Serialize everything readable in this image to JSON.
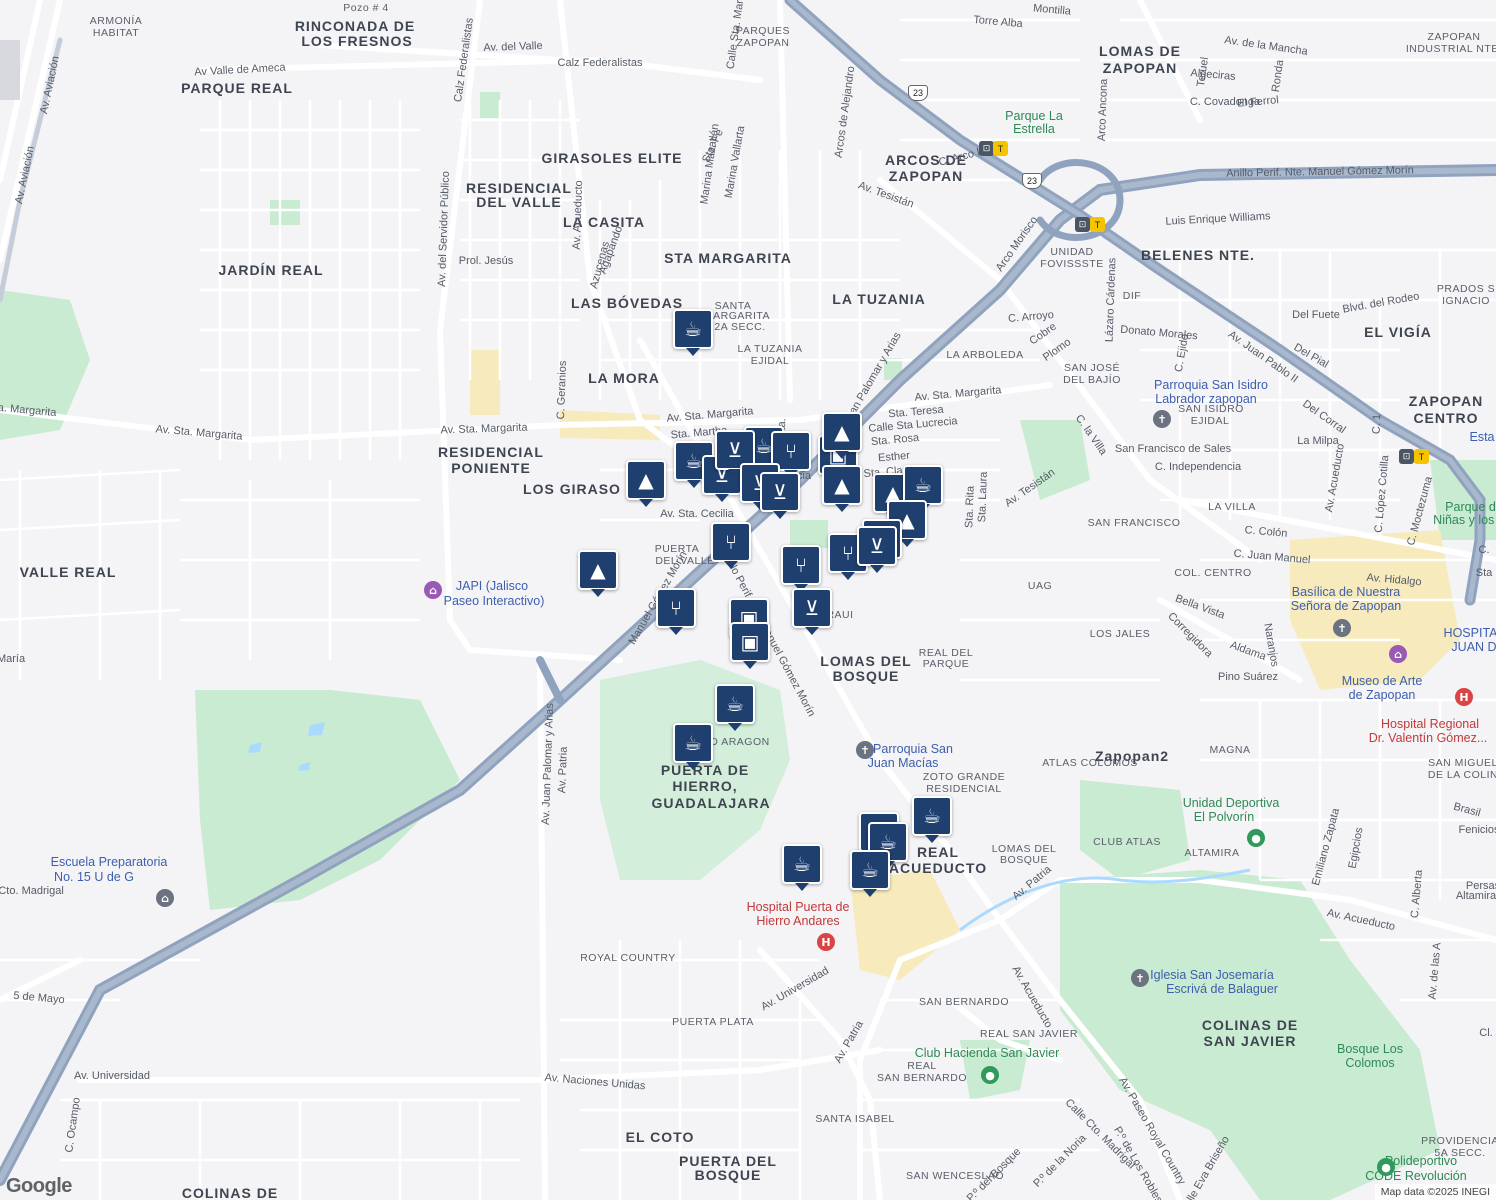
{
  "map": {
    "google_logo": "Google",
    "attribution": "Map data ©2025 INEGI",
    "neighborhoods": [
      {
        "text": "RINCONADA DE"
      },
      {
        "text": "LOS FRESNOS"
      },
      {
        "text": "PARQUE REAL"
      },
      {
        "text": "GIRASOLES ELITE"
      },
      {
        "text": "RESIDENCIAL"
      },
      {
        "text": "DEL VALLE"
      },
      {
        "text": "LA CASITA"
      },
      {
        "text": "JARDÍN REAL"
      },
      {
        "text": "STA MARGARITA"
      },
      {
        "text": "LAS BÓVEDAS"
      },
      {
        "text": "LA TUZANIA"
      },
      {
        "text": "LA MORA"
      },
      {
        "text": "RESIDENCIAL"
      },
      {
        "text": "PONIENTE"
      },
      {
        "text": "LOS GIRASO"
      },
      {
        "text": "VALLE REAL"
      },
      {
        "text": "LOMAS DE"
      },
      {
        "text": "ZAPOPAN"
      },
      {
        "text": "ARCOS DE"
      },
      {
        "text": "ZAPOPAN"
      },
      {
        "text": "BELENES NTE."
      },
      {
        "text": "EL VIGÍA"
      },
      {
        "text": "ZAPOPAN"
      },
      {
        "text": "CENTRO"
      },
      {
        "text": "LOMAS DEL"
      },
      {
        "text": "BOSQUE"
      },
      {
        "text": "PUERTA DE"
      },
      {
        "text": "HIERRO,"
      },
      {
        "text": "GUADALAJARA"
      },
      {
        "text": "REAL"
      },
      {
        "text": "ACUEDUCTO"
      },
      {
        "text": "COLINAS DE"
      },
      {
        "text": "SAN JAVIER"
      },
      {
        "text": "EL COTO"
      },
      {
        "text": "PUERTA DEL"
      },
      {
        "text": "BOSQUE"
      },
      {
        "text": "COLINAS DE"
      },
      {
        "text": "Zapopan2"
      }
    ],
    "small_labels": [
      {
        "text": "ARMONÍA"
      },
      {
        "text": "HABITAT"
      },
      {
        "text": "PARQUES"
      },
      {
        "text": "ZAPOPAN"
      },
      {
        "text": "SANTA"
      },
      {
        "text": "MARGARITA"
      },
      {
        "text": "2A SECC."
      },
      {
        "text": "LA TUZANIA"
      },
      {
        "text": "EJIDAL"
      },
      {
        "text": "LA ARBOLEDA"
      },
      {
        "text": "SAN JOSÉ"
      },
      {
        "text": "DEL BAJÍO"
      },
      {
        "text": "UNIDAD"
      },
      {
        "text": "FOVISSSTE"
      },
      {
        "text": "DIF"
      },
      {
        "text": "SAN ISIDRO"
      },
      {
        "text": "EJIDAL"
      },
      {
        "text": "SAN FRANCISCO"
      },
      {
        "text": "LA VILLA"
      },
      {
        "text": "COL. CENTRO"
      },
      {
        "text": "UAG"
      },
      {
        "text": "LOS JALES"
      },
      {
        "text": "REAL DEL"
      },
      {
        "text": "PARQUE"
      },
      {
        "text": "MAGNA"
      },
      {
        "text": "ATLAS COLOMOS"
      },
      {
        "text": "ZOTO GRANDE"
      },
      {
        "text": "RESIDENCIAL"
      },
      {
        "text": "LOMAS DEL"
      },
      {
        "text": "BOSQUE"
      },
      {
        "text": "CLUB ATLAS"
      },
      {
        "text": "ALTAMIRA"
      },
      {
        "text": "ROYAL COUNTRY"
      },
      {
        "text": "SAN BERNARDO"
      },
      {
        "text": "REAL SAN JAVIER"
      },
      {
        "text": "REAL"
      },
      {
        "text": "SAN BERNARDO"
      },
      {
        "text": "PUERTA PLATA"
      },
      {
        "text": "SANTA ISABEL"
      },
      {
        "text": "SAN WENCESLAO"
      },
      {
        "text": "PROVIDENCIA"
      },
      {
        "text": "5A SECC."
      },
      {
        "text": "ZAPOPAN"
      },
      {
        "text": "INDUSTRIAL NTE."
      },
      {
        "text": "PRADOS S"
      },
      {
        "text": "IGNACIO"
      },
      {
        "text": "PUERTA"
      },
      {
        "text": "DEL VALLE"
      },
      {
        "text": "SAN MIGUEL"
      },
      {
        "text": "DE LA COLIN"
      },
      {
        "text": "RAUI"
      },
      {
        "text": "D ARAGON"
      },
      {
        "text": "Pozo # 4"
      }
    ],
    "streets": [
      {
        "text": "Av. Aviación"
      },
      {
        "text": "Av. Aviación"
      },
      {
        "text": "Calz Federalistas"
      },
      {
        "text": "Av. del Valle"
      },
      {
        "text": "Calz Federalistas"
      },
      {
        "text": "Av Valle de Ameca"
      },
      {
        "text": "Av. del Servidor Público"
      },
      {
        "text": "Av. Acueducto"
      },
      {
        "text": "Agapando"
      },
      {
        "text": "Azucenas"
      },
      {
        "text": "Prol. Jesús"
      },
      {
        "text": "C. Geranios"
      },
      {
        "text": "Sta. Fe"
      },
      {
        "text": "Marina Mazatlán"
      },
      {
        "text": "Marina Vallarta"
      },
      {
        "text": "Calle Sta. María"
      },
      {
        "text": "Arcos de Alejandro"
      },
      {
        "text": "Av. Tesistán"
      },
      {
        "text": "C. Arco Iris"
      },
      {
        "text": "Av. de la Mancha"
      },
      {
        "text": "Algeciras"
      },
      {
        "text": "El Ferrol"
      },
      {
        "text": "C. Covadonga"
      },
      {
        "text": "Torre Alba"
      },
      {
        "text": "Montilla"
      },
      {
        "text": "Teruel"
      },
      {
        "text": "Ronda"
      },
      {
        "text": "Arco Ancona"
      },
      {
        "text": "Anillo Perif. Nte. Manuel Gómez Morín"
      },
      {
        "text": "Luis Enrique Williams"
      },
      {
        "text": "Arco Morisco"
      },
      {
        "text": "C. Arroyo"
      },
      {
        "text": "Cobre"
      },
      {
        "text": "Plomo"
      },
      {
        "text": "Lázaro Cárdenas"
      },
      {
        "text": "Donato Morales"
      },
      {
        "text": "Av. Juan Pablo II"
      },
      {
        "text": "Blvd. del Rodeo"
      },
      {
        "text": "Del Fuete"
      },
      {
        "text": "Del Pial"
      },
      {
        "text": "Del Corral"
      },
      {
        "text": "La Milpa"
      },
      {
        "text": "C. Ejido"
      },
      {
        "text": "C. 1"
      },
      {
        "text": "Av. Sta. Margarita"
      },
      {
        "text": "Av. Sta. Margarita"
      },
      {
        "text": "Av. Sta. Margarita"
      },
      {
        "text": "Sta. Margarita"
      },
      {
        "text": "Av. Sta. Margarita"
      },
      {
        "text": "Sta. Martha"
      },
      {
        "text": "Sta. Teresa"
      },
      {
        "text": "Calle Sta Lucrecia"
      },
      {
        "text": "Sta. Rosa"
      },
      {
        "text": "Esther"
      },
      {
        "text": "Sta. Clara"
      },
      {
        "text": "Av. Sta. Cecilia"
      },
      {
        "text": "Sta. Rita"
      },
      {
        "text": "Sta. Laura"
      },
      {
        "text": "Av. Tesistán"
      },
      {
        "text": "C. la Villa"
      },
      {
        "text": "San Francisco de Sales"
      },
      {
        "text": "C. Independencia"
      },
      {
        "text": "C. Colón"
      },
      {
        "text": "C. Juan Manuel"
      },
      {
        "text": "Av. Hidalgo"
      },
      {
        "text": "Bella Vista"
      },
      {
        "text": "Corregidora"
      },
      {
        "text": "Aldama"
      },
      {
        "text": "Naranjos"
      },
      {
        "text": "Pino Suárez"
      },
      {
        "text": "C. López Cotilla"
      },
      {
        "text": "C. Moctezuma"
      },
      {
        "text": "Av. Acueducto"
      },
      {
        "text": "Anillo Perif. Nte. Manuel Gómez Morín"
      },
      {
        "text": "Manuel Gómez Morín"
      },
      {
        "text": "Av. Juan Palomar y Arias"
      },
      {
        "text": "Av. Juan Palomar y Arias"
      },
      {
        "text": "Av. Patria"
      },
      {
        "text": "Av. Patria"
      },
      {
        "text": "Av. Patria"
      },
      {
        "text": "Av. Acueducto"
      },
      {
        "text": "Av. Acueducto"
      },
      {
        "text": "Av. Paseo Royal Country"
      },
      {
        "text": "Av. Universidad"
      },
      {
        "text": "Av. Universidad"
      },
      {
        "text": "Av. Naciones Unidas"
      },
      {
        "text": "C. Ocampo"
      },
      {
        "text": "5 de Mayo"
      },
      {
        "text": "Calle Cto. Madrigal"
      },
      {
        "text": "Calle Cto. Madrigal"
      },
      {
        "text": "P.º de Los Robles"
      },
      {
        "text": "P.º del Bosque"
      },
      {
        "text": "P.º de la Noria"
      },
      {
        "text": "Calle Eva Briseño"
      },
      {
        "text": "Emiliano Zapata"
      },
      {
        "text": "Egipcios"
      },
      {
        "text": "Fenicios"
      },
      {
        "text": "Persas"
      },
      {
        "text": "Altamira"
      },
      {
        "text": "C. Alberta"
      },
      {
        "text": "Av. de las A"
      },
      {
        "text": "Brasil"
      },
      {
        "text": "Cl."
      },
      {
        "text": "C."
      },
      {
        "text": "Sta"
      },
      {
        "text": "Sta."
      },
      {
        "text": "Sta."
      },
      {
        "text": "Sta."
      },
      {
        "text": "Sta"
      },
      {
        "text": "cia"
      }
    ],
    "pois": [
      {
        "text": "Parque La"
      },
      {
        "text": "Estrella"
      },
      {
        "text": "Parroquia San Isidro"
      },
      {
        "text": "Labrador zapopan"
      },
      {
        "text": "Basílica de Nuestra"
      },
      {
        "text": "Señora de Zapopan"
      },
      {
        "text": "Museo de Arte"
      },
      {
        "text": "de Zapopan"
      },
      {
        "text": "Hospital Regional"
      },
      {
        "text": "Dr. Valentín Gómez..."
      },
      {
        "text": "HOSPITAL"
      },
      {
        "text": "JUAN D"
      },
      {
        "text": "Parque de"
      },
      {
        "text": "Niñas y los N"
      },
      {
        "text": "Esta"
      },
      {
        "text": "JAPI (Jalisco"
      },
      {
        "text": "Paseo Interactivo)"
      },
      {
        "text": "Parroquia San"
      },
      {
        "text": "Juan Macías"
      },
      {
        "text": "Unidad Deportiva"
      },
      {
        "text": "El Polvorín"
      },
      {
        "text": "Hospital Puerta de"
      },
      {
        "text": "Hierro Andares"
      },
      {
        "text": "Escuela Preparatoria"
      },
      {
        "text": "No. 15 U de G"
      },
      {
        "text": "Iglesia San Josemaría"
      },
      {
        "text": "Escrivá de Balaguer"
      },
      {
        "text": "Club Hacienda San Javier"
      },
      {
        "text": "Bosque Los"
      },
      {
        "text": "Colomos"
      },
      {
        "text": "Polideportivo"
      },
      {
        "text": "CODE Revolución"
      },
      {
        "text": "María"
      }
    ],
    "shields": [
      {
        "text": "23"
      },
      {
        "text": "23"
      }
    ],
    "markers": [
      {
        "type": "cafe-icon"
      },
      {
        "type": "cafe-icon"
      },
      {
        "type": "school-icon"
      },
      {
        "type": "shopping-cart-icon"
      },
      {
        "type": "cafe-icon"
      },
      {
        "type": "restaurant-icon"
      },
      {
        "type": "shopping-cart-icon"
      },
      {
        "type": "shopping-bag-icon"
      },
      {
        "type": "school-icon"
      },
      {
        "type": "shopping-cart-icon"
      },
      {
        "type": "school-icon"
      },
      {
        "type": "shopping-cart-icon"
      },
      {
        "type": "school-icon"
      },
      {
        "type": "cafe-icon"
      },
      {
        "type": "school-icon"
      },
      {
        "type": "school-icon"
      },
      {
        "type": "school-icon"
      },
      {
        "type": "restaurant-icon"
      },
      {
        "type": "shopping-cart-icon"
      },
      {
        "type": "restaurant-icon"
      },
      {
        "type": "shopping-cart-icon"
      },
      {
        "type": "restaurant-icon"
      },
      {
        "type": "restaurant-icon"
      },
      {
        "type": "shopping-bag-icon"
      },
      {
        "type": "shopping-bag-icon"
      },
      {
        "type": "cafe-icon"
      },
      {
        "type": "cafe-icon"
      },
      {
        "type": "cafe-icon"
      },
      {
        "type": "cafe-icon"
      },
      {
        "type": "cafe-icon"
      },
      {
        "type": "cafe-icon"
      },
      {
        "type": "cafe-icon"
      }
    ],
    "colors": {
      "background": "#f4f3f6",
      "road": "#ffffff",
      "highway": "#8fa3bf",
      "green": "#c9ebd2",
      "yellow": "#f7ebbd",
      "marker": "#1f3f6e"
    }
  }
}
